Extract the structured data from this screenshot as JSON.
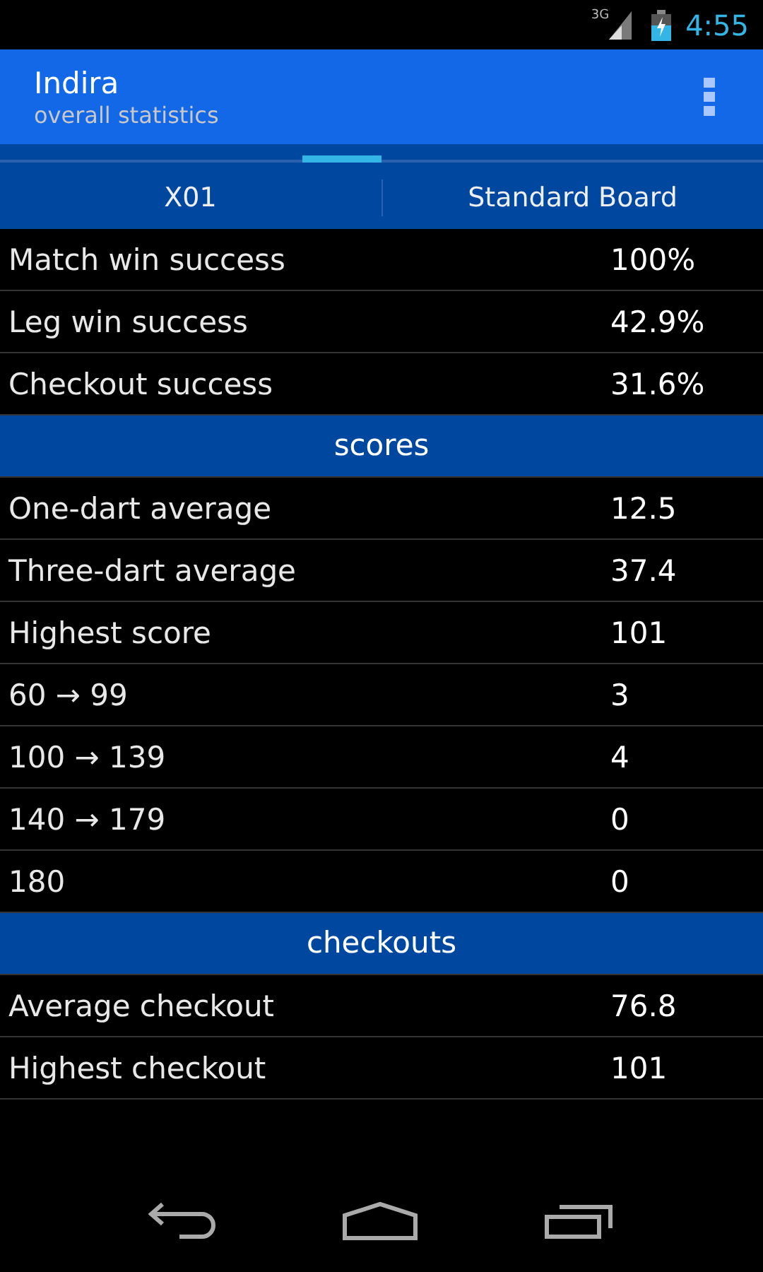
{
  "status_bar": {
    "network": "3G",
    "time": "4:55"
  },
  "action_bar": {
    "title": "Indira",
    "subtitle": "overall statistics"
  },
  "tabs": [
    "X01",
    "Standard Board"
  ],
  "rows": [
    {
      "kind": "stat",
      "label": "Match win success",
      "value": "100%"
    },
    {
      "kind": "stat",
      "label": "Leg win success",
      "value": "42.9%"
    },
    {
      "kind": "stat",
      "label": "Checkout success",
      "value": "31.6%"
    },
    {
      "kind": "section",
      "label": "scores"
    },
    {
      "kind": "stat",
      "label": "One-dart average",
      "value": "12.5"
    },
    {
      "kind": "stat",
      "label": "Three-dart average",
      "value": "37.4"
    },
    {
      "kind": "stat",
      "label": "Highest score",
      "value": "101"
    },
    {
      "kind": "stat",
      "label": "60 → 99",
      "value": "3"
    },
    {
      "kind": "stat",
      "label": "100 → 139",
      "value": "4"
    },
    {
      "kind": "stat",
      "label": "140 → 179",
      "value": "0"
    },
    {
      "kind": "stat",
      "label": "180",
      "value": "0"
    },
    {
      "kind": "section",
      "label": "checkouts"
    },
    {
      "kind": "stat",
      "label": "Average checkout",
      "value": "76.8"
    },
    {
      "kind": "stat",
      "label": "Highest checkout",
      "value": "101"
    }
  ]
}
